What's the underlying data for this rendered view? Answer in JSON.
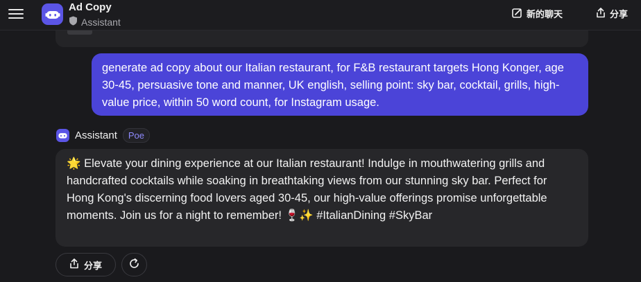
{
  "header": {
    "title": "Ad Copy",
    "subtitle": "Assistant",
    "new_chat_label": "新的聊天",
    "share_label": "分享"
  },
  "conversation": {
    "user_message": "generate ad copy about our Italian restaurant, for F&B restaurant targets Hong Konger, age 30-45, persuasive tone and manner, UK english, selling point: sky bar, cocktail, grills, high-value price, within 50 word count, for Instagram usage.",
    "assistant_name": "Assistant",
    "assistant_badge": "Poe",
    "assistant_message": "🌟 Elevate your dining experience at our Italian restaurant! Indulge in mouthwatering grills and handcrafted cocktails while soaking in breathtaking views from our stunning sky bar. Perfect for Hong Kong's discerning food lovers aged 30-45, our high-value offerings promise unforgettable moments. Join us for a night to remember! 🍷✨ #ItalianDining #SkyBar"
  },
  "actions": {
    "share_label": "分享"
  },
  "colors": {
    "accent": "#4b44d8",
    "background": "#1a1a1d",
    "assistant_bubble": "#27272a"
  },
  "icons": [
    "menu-icon",
    "bot-icon",
    "shield-icon",
    "edit-icon",
    "share-icon",
    "refresh-icon"
  ]
}
